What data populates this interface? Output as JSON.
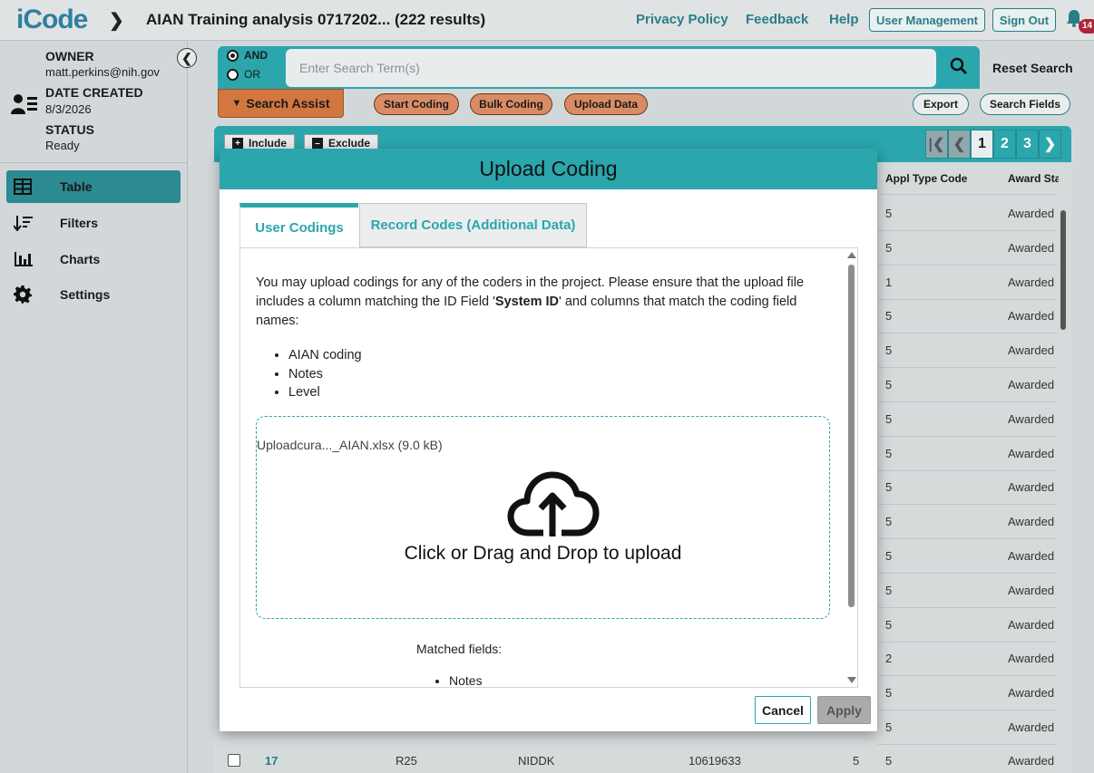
{
  "header": {
    "logo": "iCode",
    "title": "AIAN Training analysis 0717202... (222 results)",
    "links": [
      "Privacy Policy",
      "Feedback",
      "Help"
    ],
    "buttons": [
      "User Management",
      "Sign Out"
    ],
    "notification_count": "14"
  },
  "sidebar": {
    "owner_label": "OWNER",
    "owner_value": "matt.perkins@nih.gov",
    "date_label": "DATE CREATED",
    "date_value": "8/3/2026",
    "status_label": "STATUS",
    "status_value": "Ready",
    "nav": [
      {
        "label": "Table",
        "icon": "table-icon"
      },
      {
        "label": "Filters",
        "icon": "filter-sort-icon"
      },
      {
        "label": "Charts",
        "icon": "bar-chart-icon"
      },
      {
        "label": "Settings",
        "icon": "gear-icon"
      }
    ]
  },
  "search": {
    "and_label": "AND",
    "or_label": "OR",
    "placeholder": "Enter Search Term(s)",
    "reset_label": "Reset Search",
    "assist_label": "Search Assist",
    "actions": [
      "Start Coding",
      "Bulk Coding",
      "Upload Data"
    ],
    "right_actions": [
      "Export",
      "Search Fields"
    ]
  },
  "table": {
    "include_label": "Include",
    "exclude_label": "Exclude",
    "pages": [
      "1",
      "2",
      "3"
    ],
    "headers": [
      "Appl Type Code",
      "Award Status"
    ],
    "rows": [
      {
        "appl_type": "5",
        "status": "Awarded"
      },
      {
        "appl_type": "5",
        "status": "Awarded"
      },
      {
        "appl_type": "1",
        "status": "Awarded"
      },
      {
        "appl_type": "5",
        "status": "Awarded"
      },
      {
        "appl_type": "5",
        "status": "Awarded"
      },
      {
        "appl_type": "5",
        "status": "Awarded"
      },
      {
        "appl_type": "5",
        "status": "Awarded"
      },
      {
        "appl_type": "5",
        "status": "Awarded"
      },
      {
        "appl_type": "5",
        "status": "Awarded"
      },
      {
        "appl_type": "5",
        "status": "Awarded"
      },
      {
        "appl_type": "5",
        "status": "Awarded"
      },
      {
        "appl_type": "5",
        "status": "Awarded"
      },
      {
        "appl_type": "5",
        "status": "Awarded"
      },
      {
        "appl_type": "2",
        "status": "Awarded"
      },
      {
        "appl_type": "5",
        "status": "Awarded"
      },
      {
        "appl_type": "5",
        "status": "Awarded"
      }
    ],
    "last_row": {
      "id": "17",
      "activity": "R25",
      "ic": "NIDDK",
      "appl_id": "10619633",
      "col5": "5",
      "appl_type": "5",
      "status": "Awarded"
    }
  },
  "modal": {
    "title": "Upload Coding",
    "tabs": [
      "User Codings",
      "Record Codes (Additional Data)"
    ],
    "intro_before": "You may upload codings for any of the coders in the project. Please ensure that the upload file includes a column matching the ID Field '",
    "intro_bold": "System ID",
    "intro_after": "' and columns that match the coding field names:",
    "fields": [
      "AIAN coding",
      "Notes",
      "Level"
    ],
    "file_name": "Uploadcura..._AIAN.xlsx (9.0 kB)",
    "drop_text": "Click or Drag and Drop to upload",
    "matched_label": "Matched fields:",
    "matched_fields": [
      "Notes"
    ],
    "cancel_label": "Cancel",
    "apply_label": "Apply"
  }
}
